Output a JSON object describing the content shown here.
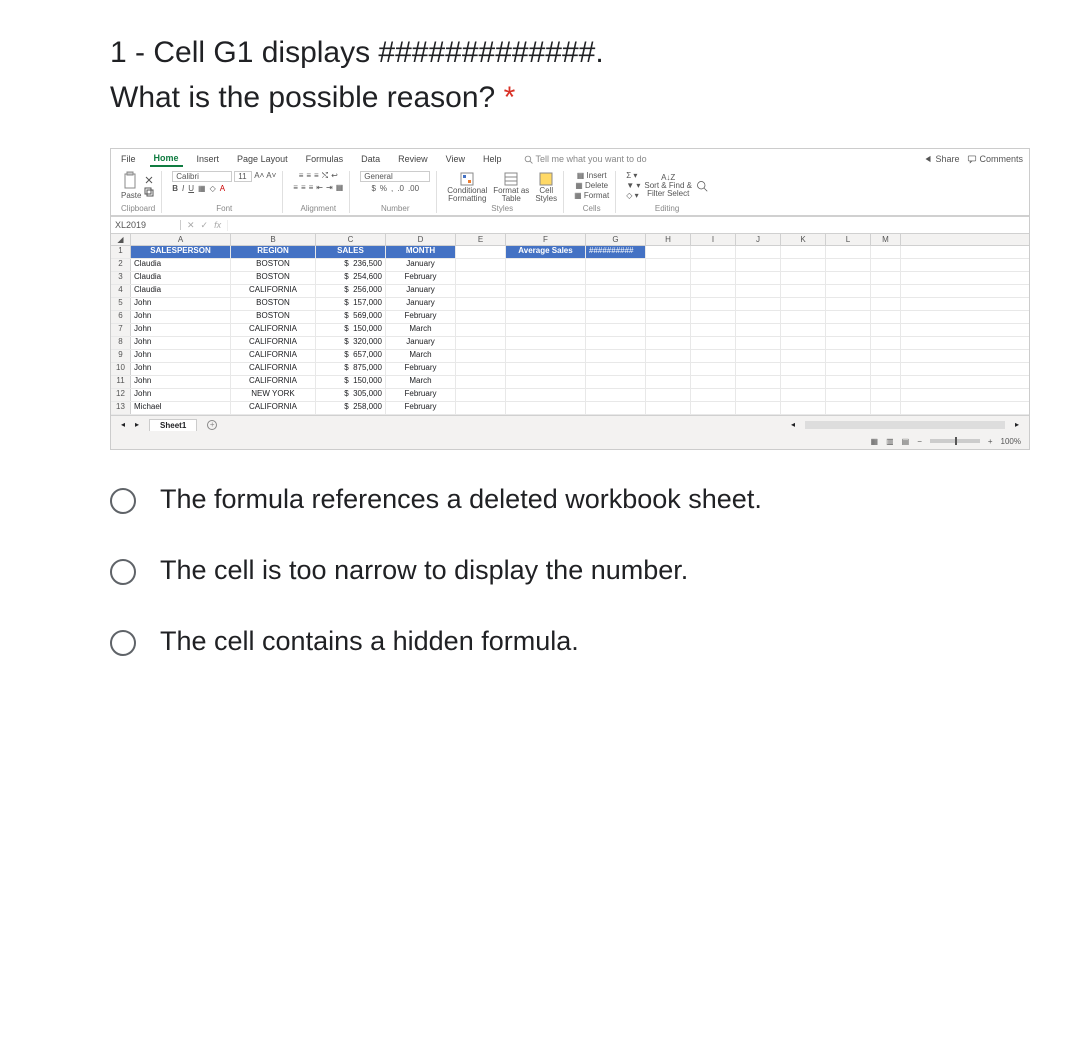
{
  "question": {
    "number": "1",
    "text_line1": "1 - Cell G1 displays #############.",
    "text_line2": "What is the possible reason?"
  },
  "options": {
    "a": "The formula references a deleted workbook sheet.",
    "b": "The cell is too narrow to display the number.",
    "c": "The cell contains a hidden formula."
  },
  "excel": {
    "tabs": {
      "file": "File",
      "home": "Home",
      "insert": "Insert",
      "page_layout": "Page Layout",
      "formulas": "Formulas",
      "data": "Data",
      "review": "Review",
      "view": "View",
      "help": "Help",
      "tell_me": "Tell me what you want to do",
      "share": "Share",
      "comments": "Comments"
    },
    "ribbon": {
      "paste": "Paste",
      "font_name": "Calibri",
      "font_size": "11",
      "clipboard": "Clipboard",
      "font": "Font",
      "alignment": "Alignment",
      "number_format": "General",
      "number": "Number",
      "conditional_formatting": "Conditional Formatting",
      "format_as_table": "Format as Table",
      "cell_styles": "Cell Styles",
      "styles": "Styles",
      "insert_btn": "Insert",
      "delete_btn": "Delete",
      "format_btn": "Format",
      "cells": "Cells",
      "sort_find": "Sort & Find &",
      "filter_select": "Filter   Select",
      "editing": "Editing",
      "bold": "B",
      "italic": "I",
      "underline": "U",
      "fill": "◇",
      "fontcolor": "A"
    },
    "namebox": "XL2019",
    "fx": "fx",
    "columns": [
      "A",
      "B",
      "C",
      "D",
      "E",
      "F",
      "G",
      "H",
      "I",
      "J",
      "K",
      "L",
      "M"
    ],
    "header_row": {
      "salesperson": "SALESPERSON",
      "region": "REGION",
      "sales": "SALES",
      "month": "MONTH",
      "avg_sales": "Average Sales",
      "hashes": "##########"
    },
    "rows": [
      {
        "n": "2",
        "sp": "Claudia",
        "rg": "BOSTON",
        "sl": "236,500",
        "mo": "January"
      },
      {
        "n": "3",
        "sp": "Claudia",
        "rg": "BOSTON",
        "sl": "254,600",
        "mo": "February"
      },
      {
        "n": "4",
        "sp": "Claudia",
        "rg": "CALIFORNIA",
        "sl": "256,000",
        "mo": "January"
      },
      {
        "n": "5",
        "sp": "John",
        "rg": "BOSTON",
        "sl": "157,000",
        "mo": "January"
      },
      {
        "n": "6",
        "sp": "John",
        "rg": "BOSTON",
        "sl": "569,000",
        "mo": "February"
      },
      {
        "n": "7",
        "sp": "John",
        "rg": "CALIFORNIA",
        "sl": "150,000",
        "mo": "March"
      },
      {
        "n": "8",
        "sp": "John",
        "rg": "CALIFORNIA",
        "sl": "320,000",
        "mo": "January"
      },
      {
        "n": "9",
        "sp": "John",
        "rg": "CALIFORNIA",
        "sl": "657,000",
        "mo": "March"
      },
      {
        "n": "10",
        "sp": "John",
        "rg": "CALIFORNIA",
        "sl": "875,000",
        "mo": "February"
      },
      {
        "n": "11",
        "sp": "John",
        "rg": "CALIFORNIA",
        "sl": "150,000",
        "mo": "March"
      },
      {
        "n": "12",
        "sp": "John",
        "rg": "NEW YORK",
        "sl": "305,000",
        "mo": "February"
      },
      {
        "n": "13",
        "sp": "Michael",
        "rg": "CALIFORNIA",
        "sl": "258,000",
        "mo": "February"
      }
    ],
    "sheet1": "Sheet1",
    "zoom": "100%"
  }
}
